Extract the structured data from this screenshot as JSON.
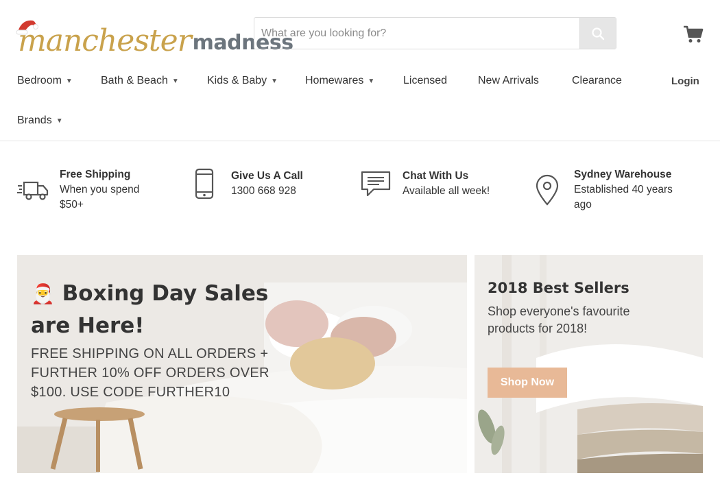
{
  "header": {
    "logo": {
      "word_1": "manchester",
      "word_2": "madness"
    },
    "search": {
      "placeholder": "What are you looking for?",
      "value": ""
    },
    "cart_icon": "cart-icon",
    "login_label": "Login"
  },
  "nav": {
    "items": [
      {
        "label": "Bedroom",
        "has_dropdown": true
      },
      {
        "label": "Bath & Beach",
        "has_dropdown": true
      },
      {
        "label": "Kids & Baby",
        "has_dropdown": true
      },
      {
        "label": "Homewares",
        "has_dropdown": true
      },
      {
        "label": "Licensed",
        "has_dropdown": false
      },
      {
        "label": "New Arrivals",
        "has_dropdown": false
      },
      {
        "label": "Clearance",
        "has_dropdown": false
      },
      {
        "label": "Brands",
        "has_dropdown": true
      }
    ]
  },
  "features": [
    {
      "icon": "delivery-truck-icon",
      "title": "Free Shipping",
      "subtitle": "When you spend $50+"
    },
    {
      "icon": "phone-icon",
      "title": "Give Us A Call",
      "subtitle": "1300 668 928"
    },
    {
      "icon": "chat-icon",
      "title": "Chat With Us",
      "subtitle": "Available all week!"
    },
    {
      "icon": "location-pin-icon",
      "title": "Sydney Warehouse",
      "subtitle": "Established 40 years ago"
    }
  ],
  "banners": {
    "left": {
      "emoji": "🎅",
      "title": "Boxing Day Sales are Here!",
      "subtitle": "FREE SHIPPING ON ALL ORDERS + FURTHER 10% OFF ORDERS OVER $100. USE CODE FURTHER10"
    },
    "right": {
      "title": "2018 Best Sellers",
      "subtitle": "Shop everyone's favourite products for 2018!",
      "button_label": "Shop Now"
    }
  },
  "colors": {
    "accent_button": "#e8b997",
    "logo_gold": "#c9a24c",
    "logo_grey": "#6c757d",
    "text": "#333333"
  }
}
